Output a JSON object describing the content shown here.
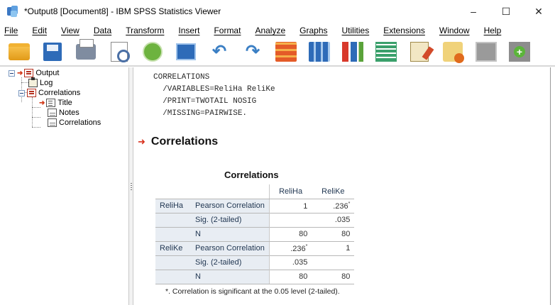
{
  "window": {
    "title": "*Output8 [Document8] - IBM SPSS Statistics Viewer",
    "controls": {
      "minimize": "–",
      "maximize": "☐",
      "close": "✕"
    }
  },
  "menu": [
    "File",
    "Edit",
    "View",
    "Data",
    "Transform",
    "Insert",
    "Format",
    "Analyze",
    "Graphs",
    "Utilities",
    "Extensions",
    "Window",
    "Help"
  ],
  "toolbar": {
    "icons": [
      "open-folder-icon",
      "save-icon",
      "print-icon",
      "print-preview-icon",
      "export-icon",
      "recall-dialog-icon",
      "undo-icon",
      "redo-icon",
      "goto-data-icon",
      "goto-case-icon",
      "variables-icon",
      "select-last-output-icon",
      "designate-window-icon",
      "run-script-icon",
      "hide-icon",
      "insert-output-icon"
    ]
  },
  "navigator": {
    "root": "Output",
    "log": "Log",
    "correlations_node": "Correlations",
    "title": "Title",
    "notes": "Notes",
    "correlations_table": "Correlations"
  },
  "syntax_lines": [
    "CORRELATIONS",
    "  /VARIABLES=ReliHa ReliKe",
    "  /PRINT=TWOTAIL NOSIG",
    "  /MISSING=PAIRWISE."
  ],
  "section_title": "Correlations",
  "table": {
    "caption": "Correlations",
    "col_headers": [
      "ReliHa",
      "ReliKe"
    ],
    "rows": [
      {
        "var": "ReliHa",
        "stat": "Pearson Correlation",
        "v1": "1",
        "v2": ".236",
        "v2_mark": "*",
        "v1_mark": ""
      },
      {
        "var": "",
        "stat": "Sig. (2-tailed)",
        "v1": "",
        "v2": ".035",
        "v1_mark": "",
        "v2_mark": ""
      },
      {
        "var": "",
        "stat": "N",
        "v1": "80",
        "v2": "80",
        "v1_mark": "",
        "v2_mark": ""
      },
      {
        "var": "ReliKe",
        "stat": "Pearson Correlation",
        "v1": ".236",
        "v1_mark": "*",
        "v2": "1",
        "v2_mark": ""
      },
      {
        "var": "",
        "stat": "Sig. (2-tailed)",
        "v1": ".035",
        "v2": "",
        "v1_mark": "",
        "v2_mark": ""
      },
      {
        "var": "",
        "stat": "N",
        "v1": "80",
        "v2": "80",
        "v1_mark": "",
        "v2_mark": ""
      }
    ],
    "footnote": "*. Correlation is significant at the 0.05 level (2-tailed)."
  },
  "colors": {
    "accent_red": "#d8301c",
    "table_label_bg": "#e8edf3"
  }
}
